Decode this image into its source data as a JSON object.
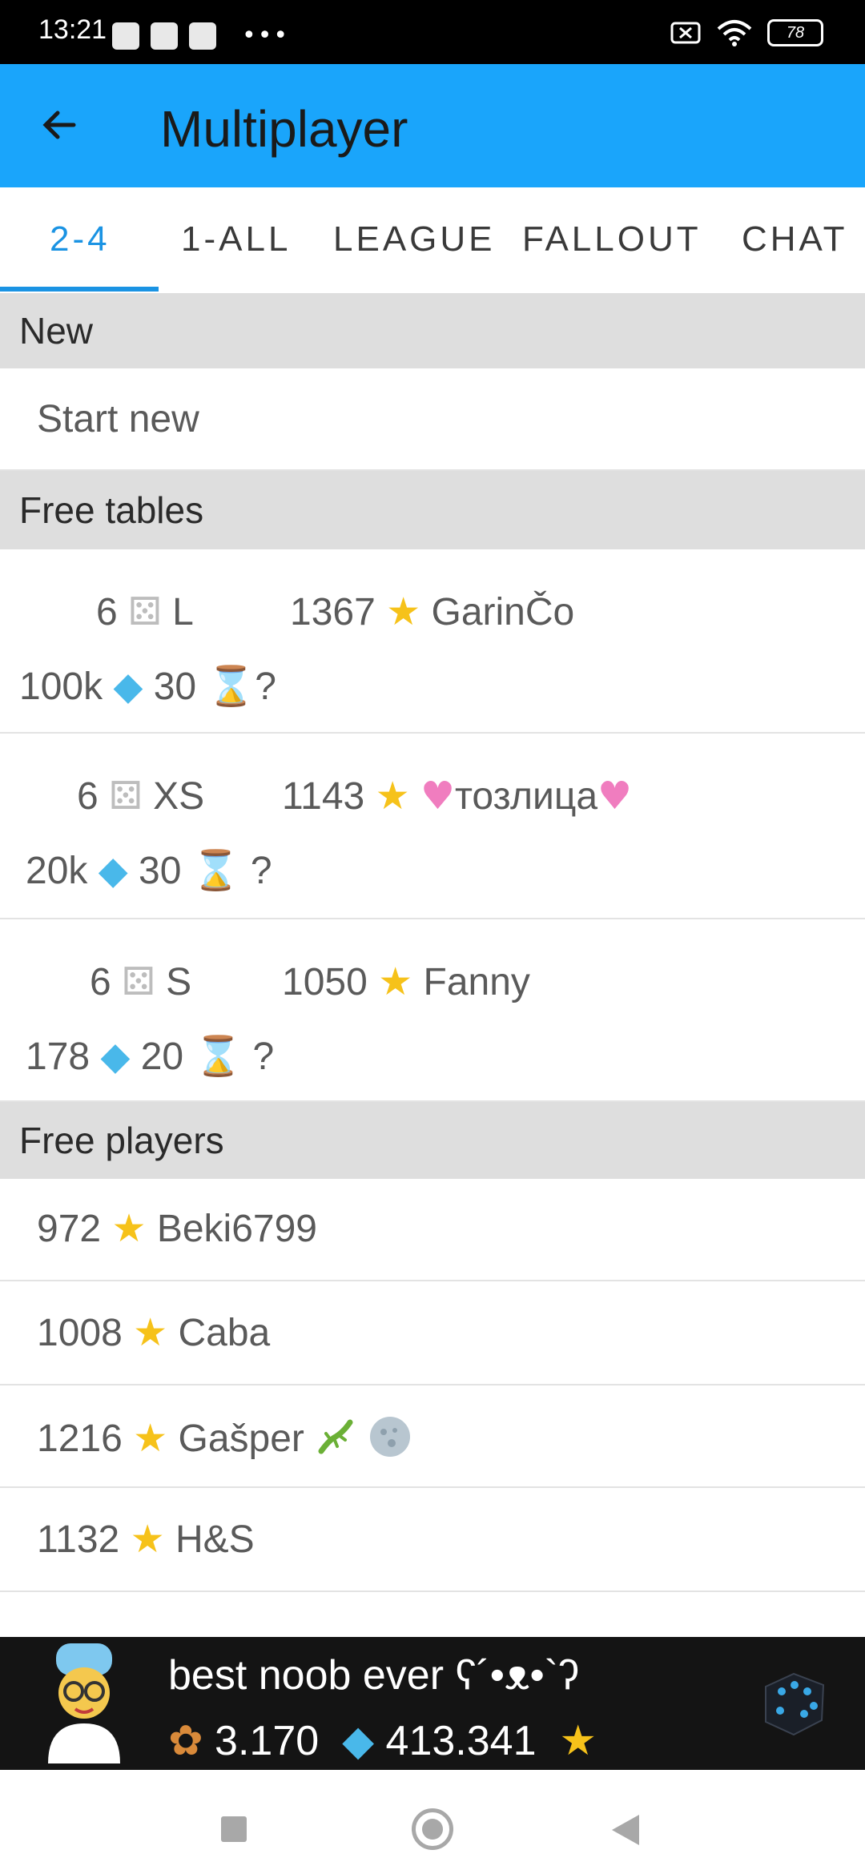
{
  "status_bar": {
    "time": "13:21",
    "battery": "78",
    "dots": "•••"
  },
  "app_bar": {
    "title": "Multiplayer",
    "back_icon": "arrow-left-icon"
  },
  "tabs": [
    {
      "label": "2-4",
      "active": true
    },
    {
      "label": "1-ALL",
      "active": false
    },
    {
      "label": "LEAGUE",
      "active": false
    },
    {
      "label": "FALLOUT",
      "active": false
    },
    {
      "label": "CHAT",
      "active": false
    }
  ],
  "sections": {
    "new": {
      "title": "New",
      "start_new": "Start new"
    },
    "free_tables": {
      "title": "Free tables",
      "tables": [
        {
          "dice_count": "6",
          "size": "L",
          "rating": "1367",
          "player": "GarinČo",
          "stake": "100k",
          "time": "30",
          "extra": "?"
        },
        {
          "dice_count": "6",
          "size": "XS",
          "rating": "1143",
          "player": "тозлица",
          "player_decor": "heart",
          "stake": "20k",
          "time": "30",
          "extra": "?"
        },
        {
          "dice_count": "6",
          "size": "S",
          "rating": "1050",
          "player": "Fanny",
          "stake": "178",
          "time": "20",
          "extra": "?"
        }
      ]
    },
    "free_players": {
      "title": "Free players",
      "players": [
        {
          "rating": "972",
          "name": "Beki6799"
        },
        {
          "rating": "1008",
          "name": "Caba"
        },
        {
          "rating": "1216",
          "name": "Gašper"
        },
        {
          "rating": "1132",
          "name": "H&S"
        }
      ]
    }
  },
  "profile": {
    "name": "best noob ever ʕ´•ᴥ•`ʔ",
    "pretzels": "3.170",
    "gems": "413.341"
  },
  "glyphs": {
    "star": "★",
    "gem": "◆",
    "dice": "⚄",
    "hourglass": "⌛",
    "heart": "♥",
    "pretzel": "✿"
  },
  "colors": {
    "app_bar": "#1aa5fb",
    "tab_active": "#1a93e3",
    "section_header_bg": "#dedede",
    "star": "#f6c21a",
    "gem": "#49b8ea"
  }
}
